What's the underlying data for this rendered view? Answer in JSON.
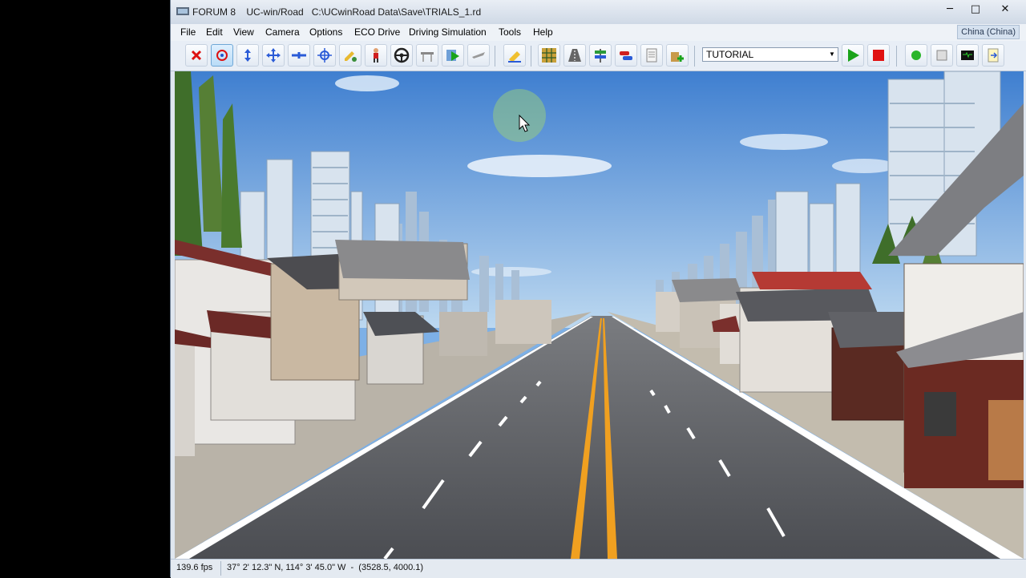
{
  "window": {
    "app_name": "FORUM 8",
    "title": "UC-win/Road   C:\\UCwinRoad Data\\Save\\TRIALS_1.rd",
    "minimize_glyph": "─",
    "maximize_glyph": "□",
    "close_glyph": "✕"
  },
  "menu": {
    "items": [
      "File",
      "Edit",
      "View",
      "Camera",
      "Options",
      "ECO Drive",
      "Driving Simulation",
      "Tools",
      "Help"
    ],
    "language": "China (China)"
  },
  "toolbar": {
    "scenario_select": {
      "value": "TUTORIAL"
    },
    "icons": [
      "close-x-icon",
      "rotate-icon",
      "updown-icon",
      "move-icon",
      "fly-icon",
      "rotate-view-icon",
      "edit-icon",
      "walk-icon",
      "steering-wheel-icon",
      "bridge-icon",
      "play-scenario-icon",
      "plane-icon",
      "eraser-icon",
      "terrain-grid-icon",
      "road-icon",
      "signpost-icon",
      "cars-icon",
      "document-icon",
      "add-model-icon",
      "play-icon",
      "stop-icon",
      "record-icon",
      "stop-record-icon",
      "console-icon",
      "log-icon"
    ],
    "colors": {
      "play": "#1aa31a",
      "stop": "#e01010",
      "record": "#2ab52a"
    }
  },
  "statusbar": {
    "fps": "139.6 fps",
    "coordinates": "37° 2' 12.3\" N, 114° 3' 45.0\" W  -  (3528.5, 4000.1)"
  }
}
